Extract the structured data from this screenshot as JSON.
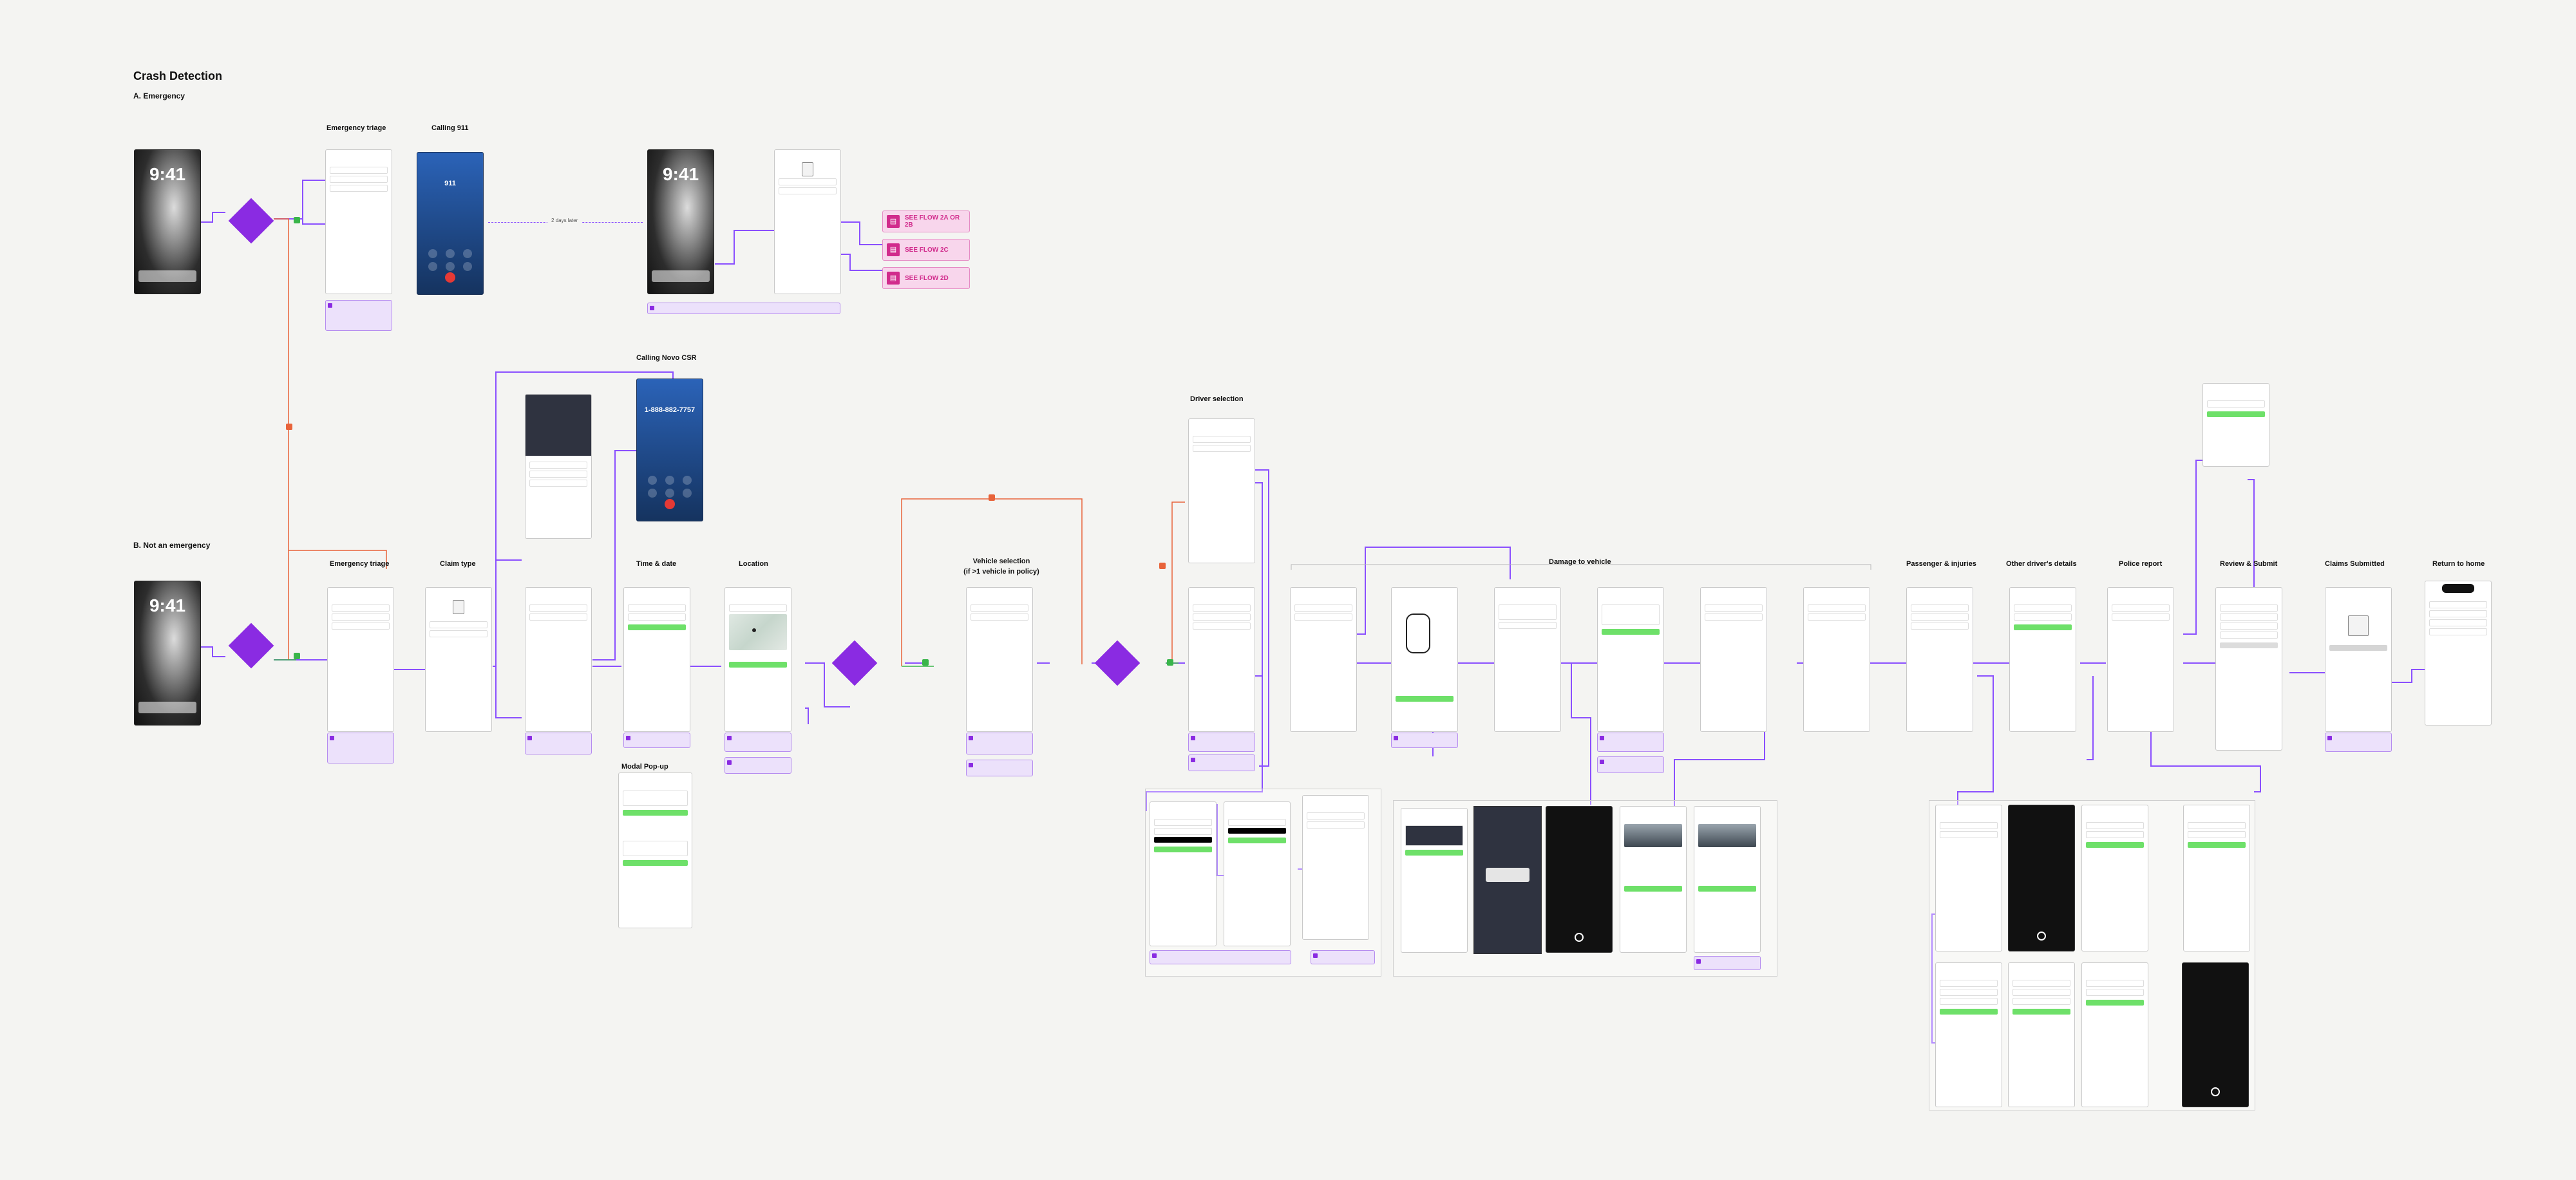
{
  "page": {
    "title": "Crash Detection",
    "section_a": "A. Emergency",
    "section_b": "B. Not an emergency"
  },
  "headers": {
    "emergency_triage": "Emergency triage",
    "calling_911": "Calling 911",
    "calling_novo": "Calling Novo CSR",
    "claim_type": "Claim type",
    "time_date": "Time & date",
    "location": "Location",
    "vehicle_selection": "Vehicle selection",
    "vehicle_selection_sub": "(if >1 vehicle in policy)",
    "driver_selection": "Driver selection",
    "damage_to_vehicle": "Damage to vehicle",
    "passenger_injuries": "Passenger & injuries",
    "other_driver": "Other driver's details",
    "police_report": "Police report",
    "review_submit": "Review & Submit",
    "claims_submitted": "Claims Submitted",
    "return_home": "Return to home",
    "modal_popup": "Modal Pop-up"
  },
  "lock": {
    "time": "9:41"
  },
  "call": {
    "number_911": "911",
    "number_novo": "1-888-882-7757"
  },
  "labels": {
    "two_days_later": "2 days later"
  },
  "flows": {
    "f1": "SEE FLOW 2A OR 2B",
    "f2": "SEE FLOW 2C",
    "f3": "SEE FLOW 2D"
  },
  "icons": {
    "flow": "document-icon",
    "diamond": "decision-diamond",
    "note": "note-icon",
    "car": "car-outline-icon",
    "camera": "camera-shutter-icon"
  },
  "colors": {
    "accent": "#8a2be2",
    "flow_pink": "#d12b8c",
    "cta_green": "#6ee069",
    "wire_purple": "#8a4fff",
    "wire_orange": "#e8633a"
  }
}
